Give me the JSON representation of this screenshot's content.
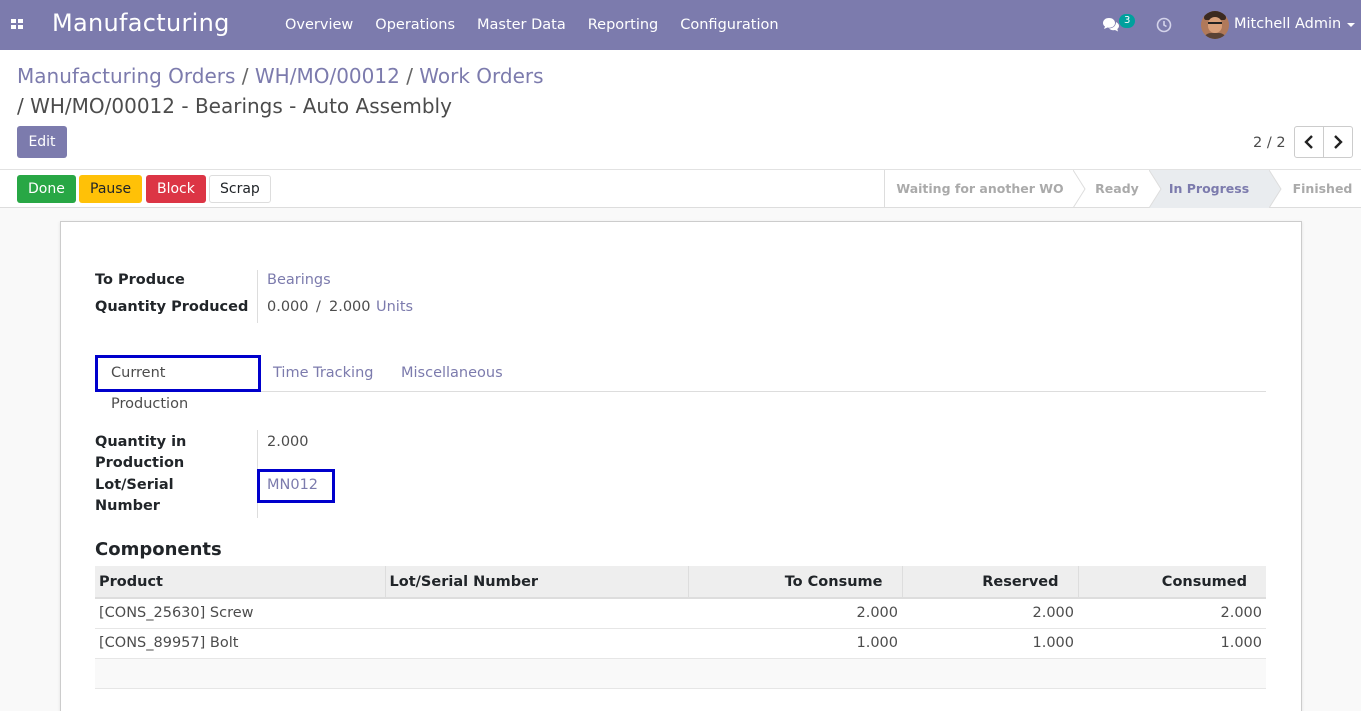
{
  "navbar": {
    "brand": "Manufacturing",
    "menu": [
      "Overview",
      "Operations",
      "Master Data",
      "Reporting",
      "Configuration"
    ],
    "chat_count": "3",
    "user_name": "Mitchell Admin"
  },
  "breadcrumb": {
    "items": [
      "Manufacturing Orders",
      "WH/MO/00012",
      "Work Orders"
    ],
    "current": "/ WH/MO/00012 - Bearings - Auto Assembly"
  },
  "actions": {
    "edit": "Edit"
  },
  "pager": {
    "value": "2 / 2"
  },
  "status_buttons": {
    "done": "Done",
    "pause": "Pause",
    "block": "Block",
    "scrap": "Scrap"
  },
  "stages": [
    "Waiting for another WO",
    "Ready",
    "In Progress",
    "Finished"
  ],
  "active_stage": "In Progress",
  "form": {
    "to_produce_label": "To Produce",
    "to_produce_value": "Bearings",
    "qty_produced_label": "Quantity Produced",
    "qty_produced_value": "0.000",
    "qty_produced_sep": "/",
    "qty_total": "2.000",
    "qty_uom": "Units"
  },
  "tabs": [
    "Current Production",
    "Time Tracking",
    "Miscellaneous"
  ],
  "current_production": {
    "qty_in_production_label_1": "Quantity in",
    "qty_in_production_label_2": "Production",
    "qty_in_production_value": "2.000",
    "lot_label_1": "Lot/Serial",
    "lot_label_2": "Number",
    "lot_value": "MN012"
  },
  "components": {
    "title": "Components",
    "headers": [
      "Product",
      "Lot/Serial Number",
      "To Consume",
      "Reserved",
      "Consumed"
    ],
    "rows": [
      {
        "product": "[CONS_25630] Screw",
        "lot": "",
        "to_consume": "2.000",
        "reserved": "2.000",
        "consumed": "2.000"
      },
      {
        "product": "[CONS_89957] Bolt",
        "lot": "",
        "to_consume": "1.000",
        "reserved": "1.000",
        "consumed": "1.000"
      }
    ]
  },
  "colors": {
    "brand": "#7c7bad",
    "done": "#28a745",
    "pause": "#ffc107",
    "block": "#dc3545",
    "highlight": "#0000cc"
  }
}
